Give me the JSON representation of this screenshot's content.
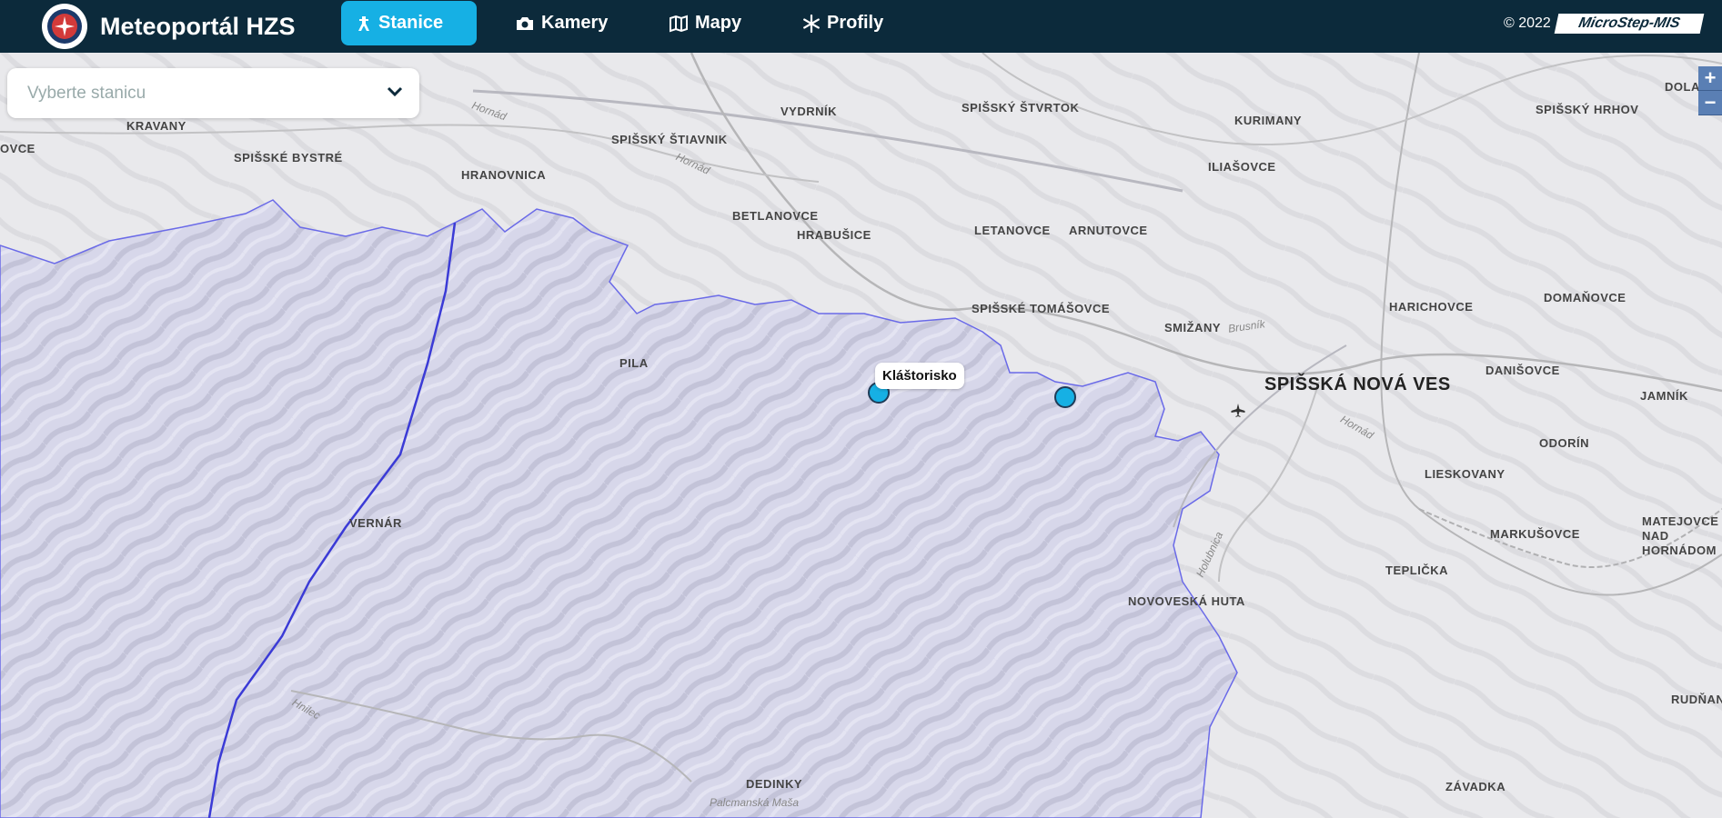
{
  "header": {
    "title": "Meteoportál HZS",
    "nav": [
      {
        "label": "Stanice",
        "icon": "tower-icon",
        "active": true
      },
      {
        "label": "Kamery",
        "icon": "camera-icon",
        "active": false
      },
      {
        "label": "Mapy",
        "icon": "map-icon",
        "active": false
      },
      {
        "label": "Profily",
        "icon": "snowflake-icon",
        "active": false
      }
    ],
    "copyright": "© 2022",
    "partner_logo": "MicroStep-MIS"
  },
  "station_select": {
    "placeholder": "Vyberte stanicu"
  },
  "zoom": {
    "in": "+",
    "out": "−"
  },
  "map": {
    "places": {
      "kravany": "KRAVANY",
      "spisske_bystre": "SPIŠSKÉ BYSTRÉ",
      "hranovnica": "HRANOVNICA",
      "spissky_stiavnik": "SPIŠSKÝ ŠTIAVNIK",
      "vydrnik": "VYDRNÍK",
      "betlanovce": "BETLANOVCE",
      "hrabusice": "HRABUŠICE",
      "spissky_stvrtok": "SPIŠSKÝ ŠTVRTOK",
      "kurimany": "KURIMANY",
      "iliasovce": "ILIAŠOVCE",
      "letanovce": "LETANOVCE",
      "arnutovce": "ARNUTOVCE",
      "spisske_tomasovce": "SPIŠSKÉ TOMÁŠOVCE",
      "smizany": "SMIŽANY",
      "pila": "PILA",
      "vernar": "VERNÁR",
      "spisska_nova_ves": "SPIŠSKÁ NOVÁ VES",
      "harichovce": "HARICHOVCE",
      "domanovce": "DOMAŇOVCE",
      "danisovce": "DANIŠOVCE",
      "jamnik": "JAMNÍK",
      "odorin": "ODORÍN",
      "lieskovany": "LIESKOVANY",
      "markusovce": "MARKUŠOVCE",
      "matejovce": "MATEJOVCE NAD HORNÁDOM",
      "teplicka": "TEPLIČKA",
      "novoveska_huta": "NOVOVESKÁ HUTA",
      "dedinky": "DEDINKY",
      "rudnany": "RUDŇANY",
      "zavadka": "ZÁVADKA",
      "spissky_hrhov": "SPIŠSKÝ HRHOV",
      "dolany": "DOLANY",
      "ovce": "OVCE",
      "palcmanska_masa": "Palcmanská Maša"
    },
    "rivers": {
      "hornad1": "Hornád",
      "hornad2": "Hornád",
      "brusnik": "Brusník",
      "hornad3": "Hornád",
      "holubnica": "Holubnica",
      "hnilec": "Hnilec"
    },
    "stations": [
      {
        "name": "Kláštorisko",
        "label_visible": true
      },
      {
        "name": "",
        "label_visible": false
      }
    ],
    "national_park_fill": "#d9d9ef",
    "border_color": "#4a4ae0"
  }
}
